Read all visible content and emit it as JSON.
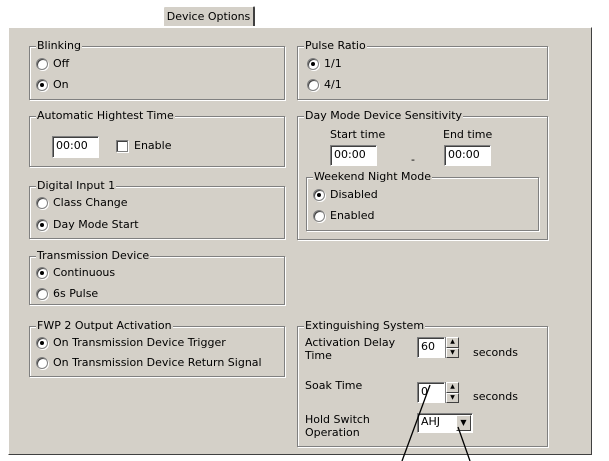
{
  "tab": {
    "label": "Device Options"
  },
  "blinking": {
    "title": "Blinking",
    "options": [
      {
        "label": "Off",
        "selected": false
      },
      {
        "label": "On",
        "selected": true
      }
    ]
  },
  "auto_time": {
    "title": "Automatic Hightest Time",
    "value": "00:00",
    "enable_label": "Enable",
    "enabled": false
  },
  "digital_input": {
    "title": "Digital Input 1",
    "options": [
      {
        "label": "Class Change",
        "selected": false
      },
      {
        "label": "Day Mode Start",
        "selected": true
      }
    ]
  },
  "transmission": {
    "title": "Transmission Device",
    "options": [
      {
        "label": "Continuous",
        "selected": true
      },
      {
        "label": "6s Pulse",
        "selected": false
      }
    ]
  },
  "fwp": {
    "title": "FWP 2 Output Activation",
    "options": [
      {
        "label": "On Transmission Device Trigger",
        "selected": true
      },
      {
        "label": "On Transmission Device Return Signal",
        "selected": false
      }
    ]
  },
  "pulse_ratio": {
    "title": "Pulse Ratio",
    "options": [
      {
        "label": "1/1",
        "selected": true
      },
      {
        "label": "4/1",
        "selected": false
      }
    ]
  },
  "day_mode": {
    "title": "Day Mode Device Sensitivity",
    "start_label": "Start time",
    "end_label": "End time",
    "start_value": "00:00",
    "end_value": "00:00",
    "separator": "-",
    "weekend": {
      "title": "Weekend Night Mode",
      "options": [
        {
          "label": "Disabled",
          "selected": true
        },
        {
          "label": "Enabled",
          "selected": false
        }
      ]
    }
  },
  "extinguishing": {
    "title": "Extinguishing System",
    "activation_label_1": "Activation Delay",
    "activation_label_2": "Time",
    "activation_value": "60",
    "activation_unit": "seconds",
    "soak_label": "Soak Time",
    "soak_value": "0",
    "soak_unit": "seconds",
    "hold_label_1": "Hold Switch",
    "hold_label_2": "Operation",
    "hold_value": "AHJ"
  },
  "icons": {
    "spin_up": "spin-up-icon",
    "spin_down": "spin-down-icon",
    "dropdown": "chevron-down-icon"
  }
}
